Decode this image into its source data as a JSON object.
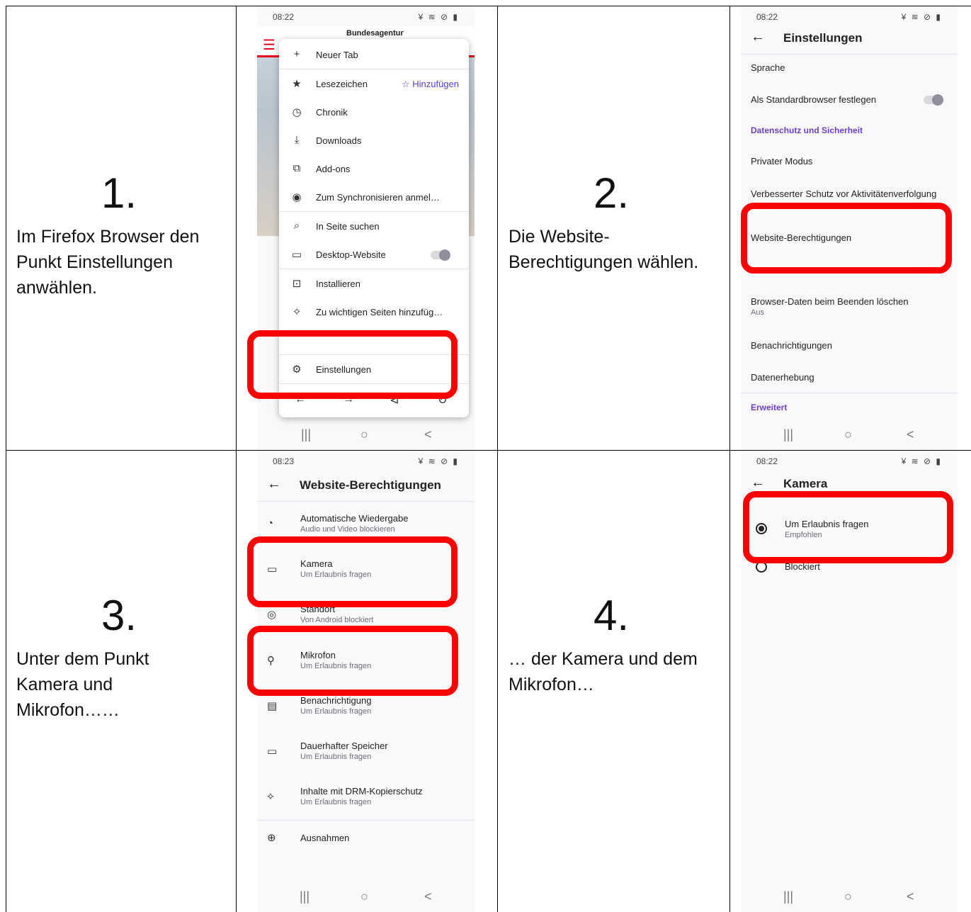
{
  "steps": [
    {
      "number": "1.",
      "text": "Im Firefox Browser den Punkt Einstellungen anwählen."
    },
    {
      "number": "2.",
      "text": "Die Website-Berechtigungen wählen."
    },
    {
      "number": "3.",
      "text": "Unter dem Punkt Kamera und Mikrofon……"
    },
    {
      "number": "4.",
      "text": "… der Kamera und dem Mikrofon…"
    }
  ],
  "phone1": {
    "time": "08:22",
    "site_title": "Bundesagentur",
    "menu": [
      {
        "icon": "plus-icon",
        "glyph": "+",
        "label": "Neuer Tab"
      },
      {
        "icon": "star-icon",
        "glyph": "★",
        "label": "Lesezeichen",
        "extra": "☆ Hinzufügen"
      },
      {
        "icon": "clock-icon",
        "glyph": "◷",
        "label": "Chronik"
      },
      {
        "icon": "download-icon",
        "glyph": "⤓",
        "label": "Downloads"
      },
      {
        "icon": "puzzle-icon",
        "glyph": "⧉",
        "label": "Add-ons"
      },
      {
        "icon": "account-icon",
        "glyph": "◉",
        "label": "Zum Synchronisieren anmel…"
      },
      {
        "icon": "search-icon",
        "glyph": "⌕",
        "label": "In Seite suchen"
      },
      {
        "icon": "desktop-icon",
        "glyph": "▭",
        "label": "Desktop-Website"
      },
      {
        "icon": "install-icon",
        "glyph": "⊡",
        "label": "Installieren"
      },
      {
        "icon": "pin-icon",
        "glyph": "✧",
        "label": "Zu wichtigen Seiten hinzufüg…"
      },
      {
        "icon": "gear-icon",
        "glyph": "⚙",
        "label": "Einstellungen"
      }
    ]
  },
  "phone2": {
    "time": "08:22",
    "title": "Einstellungen",
    "rows": {
      "sprache": "Sprache",
      "standard": "Als Standardbrowser festlegen",
      "section_privacy": "Datenschutz und Sicherheit",
      "privat": "Privater Modus",
      "tracking": "Verbesserter Schutz vor Aktivitätenverfolgung",
      "website": "Website-Berechtigungen",
      "browserdaten": "Browser-Daten beim Beenden löschen",
      "browserdaten_sub": "Aus",
      "benachrichtigungen": "Benachrichtigungen",
      "datenerhebung": "Datenerhebung",
      "section_advanced": "Erweitert"
    }
  },
  "phone3": {
    "time": "08:23",
    "title": "Website-Berechtigungen",
    "rows": [
      {
        "icon": "autoplay-icon",
        "glyph": "◔",
        "label": "Automatische Wiedergabe",
        "sub": "Audio und Video blockieren"
      },
      {
        "icon": "camera-icon",
        "glyph": "▭",
        "label": "Kamera",
        "sub": "Um Erlaubnis fragen"
      },
      {
        "icon": "location-icon",
        "glyph": "◎",
        "label": "Standort",
        "sub": "Von Android blockiert"
      },
      {
        "icon": "microphone-icon",
        "glyph": "⚲",
        "label": "Mikrofon",
        "sub": "Um Erlaubnis fragen"
      },
      {
        "icon": "notification-icon",
        "glyph": "▤",
        "label": "Benachrichtigung",
        "sub": "Um Erlaubnis fragen"
      },
      {
        "icon": "storage-icon",
        "glyph": "▭",
        "label": "Dauerhafter Speicher",
        "sub": "Um Erlaubnis fragen"
      },
      {
        "icon": "drm-icon",
        "glyph": "⟡",
        "label": "Inhalte mit DRM-Kopierschutz",
        "sub": "Um Erlaubnis fragen"
      },
      {
        "icon": "globe-icon",
        "glyph": "⊕",
        "label": "Ausnahmen",
        "sub": ""
      }
    ]
  },
  "phone4": {
    "time": "08:22",
    "title": "Kamera",
    "options": [
      {
        "label": "Um Erlaubnis fragen",
        "sub": "Empfohlen",
        "selected": true
      },
      {
        "label": "Blockiert",
        "sub": "",
        "selected": false
      }
    ]
  },
  "nav": {
    "recent": "|||",
    "home": "○",
    "back": "<"
  },
  "common": {
    "back_arrow": "←",
    "status_icons": "¥ ≋ ⊘ ▮"
  }
}
